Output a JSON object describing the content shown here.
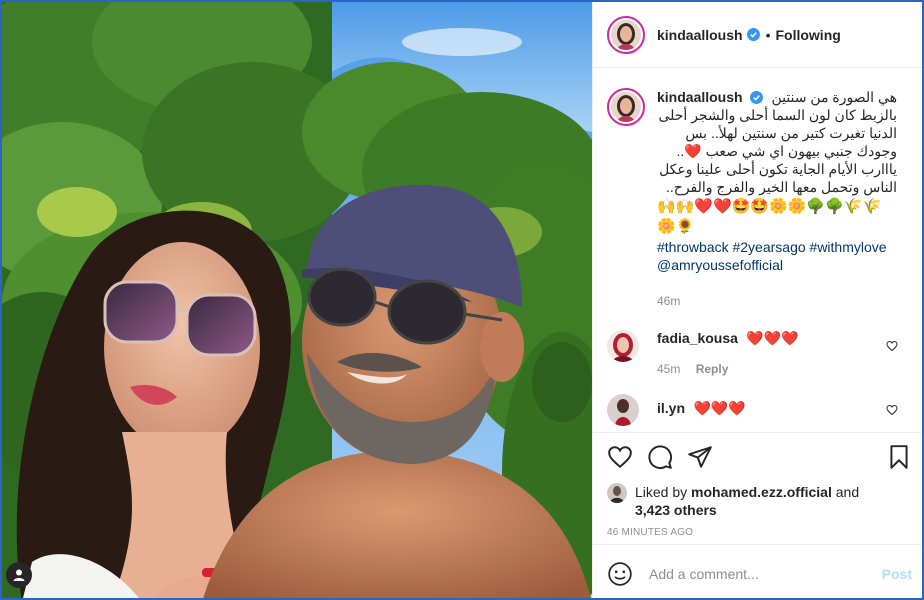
{
  "post": {
    "username": "kindaalloush",
    "follow_status": "Following",
    "separator": "•"
  },
  "caption": {
    "username": "kindaalloush",
    "lines": [
      "هي الصورة من سنتين",
      "بالزبط كان لون السما أحلى والشجر أحلى",
      "الدنيا تغيرت كتير من سنتين لهلأ.. بس",
      "وجودك جنبي بيهون اي شي صعب ❤️..",
      "يااارب الأيام الجاية تكون أحلى علينا وعكل",
      "الناس وتحمل معها الخير والفرج والفرح.."
    ],
    "emoji_line_1": "🙌🙌❤️❤️🤩🤩🌼🌼🌳🌳🌾🌾",
    "emoji_line_2": "🌼🌻",
    "hashtags": "#throwback #2yearsago #withmylove",
    "mention": "@amryoussefofficial",
    "age": "46m"
  },
  "comments": [
    {
      "username": "fadia_kousa",
      "text": "❤️❤️❤️",
      "age": "45m",
      "reply": "Reply"
    },
    {
      "username": "il.yn",
      "text": "❤️❤️❤️"
    }
  ],
  "likes": {
    "prefix": "Liked by",
    "user": "mohamed.ezz.official",
    "joiner": "and",
    "others": "3,423 others"
  },
  "timestamp": "46 MINUTES AGO",
  "comment_box": {
    "placeholder": "Add a comment...",
    "post_label": "Post"
  },
  "colors": {
    "accent_link": "#00376b",
    "post_disabled": "#b2dffc",
    "heart": "#e0245e",
    "verified": "#3897f0"
  },
  "icons": [
    "user-tag-icon",
    "verified-badge-icon",
    "heart-icon",
    "comment-icon",
    "share-icon",
    "bookmark-icon",
    "emoji-icon"
  ]
}
